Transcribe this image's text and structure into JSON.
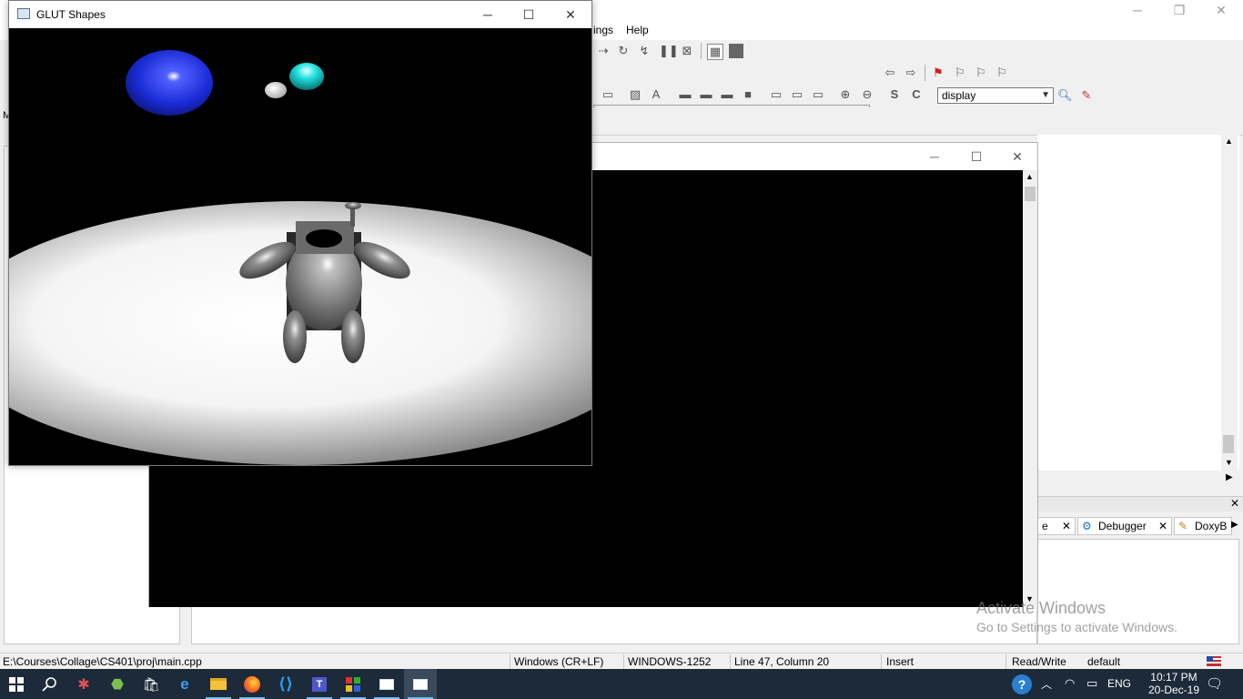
{
  "codeblocks": {
    "menu": {
      "settings_partial": "ings",
      "help": "Help"
    },
    "function_combo": {
      "value": "display"
    },
    "logs_tabs": [
      {
        "label": "e"
      },
      {
        "label": "Debugger"
      },
      {
        "label": "DoxyB"
      }
    ],
    "left_label": "M"
  },
  "glut_window": {
    "title": "GLUT Shapes"
  },
  "statusbar": {
    "path": "E:\\Courses\\Collage\\CS401\\proj\\main.cpp",
    "line_endings": "Windows (CR+LF)",
    "encoding": "WINDOWS-1252",
    "position": "Line 47, Column 20",
    "mode": "Insert",
    "access": "Read/Write",
    "profile": "default"
  },
  "watermark": {
    "title": "Activate Windows",
    "subtitle": "Go to Settings to activate Windows."
  },
  "taskbar": {
    "language": "ENG",
    "time": "10:17 PM",
    "date": "20-Dec-19"
  },
  "colors": {
    "taskbar_bg": "#1c2a3a",
    "sphere_blue": "#1a2bd6",
    "sphere_cyan": "#22e0e0"
  },
  "icons": [
    "windows-start-icon",
    "search-icon",
    "taskbar-app-icons",
    "help-icon",
    "chevron-up-icon",
    "wifi-icon",
    "battery-icon",
    "notification-icon",
    "flag-icon"
  ]
}
